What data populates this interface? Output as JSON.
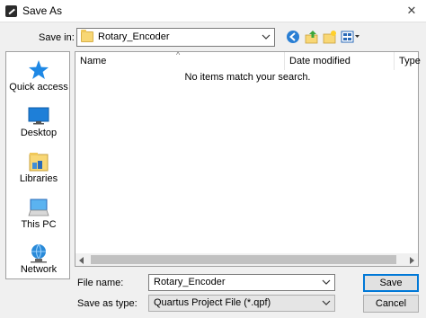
{
  "window": {
    "title": "Save As",
    "close_glyph": "✕"
  },
  "location": {
    "label": "Save in:",
    "value": "Rotary_Encoder"
  },
  "places": [
    {
      "label": "Quick access",
      "icon": "star-icon"
    },
    {
      "label": "Desktop",
      "icon": "desktop-icon"
    },
    {
      "label": "Libraries",
      "icon": "libraries-icon"
    },
    {
      "label": "This PC",
      "icon": "computer-icon"
    },
    {
      "label": "Network",
      "icon": "network-icon"
    }
  ],
  "file_list": {
    "columns": [
      "Name",
      "Date modified",
      "Type"
    ],
    "sort_glyph": "^",
    "empty_message": "No items match your search."
  },
  "form": {
    "filename_label": "File name:",
    "filename_value": "Rotary_Encoder",
    "type_label": "Save as type:",
    "type_value": "Quartus Project File (*.qpf)"
  },
  "buttons": {
    "save": "Save",
    "cancel": "Cancel"
  },
  "colors": {
    "accent": "#0078d7",
    "folder": "#f8d775",
    "star": "#1e88e5"
  }
}
